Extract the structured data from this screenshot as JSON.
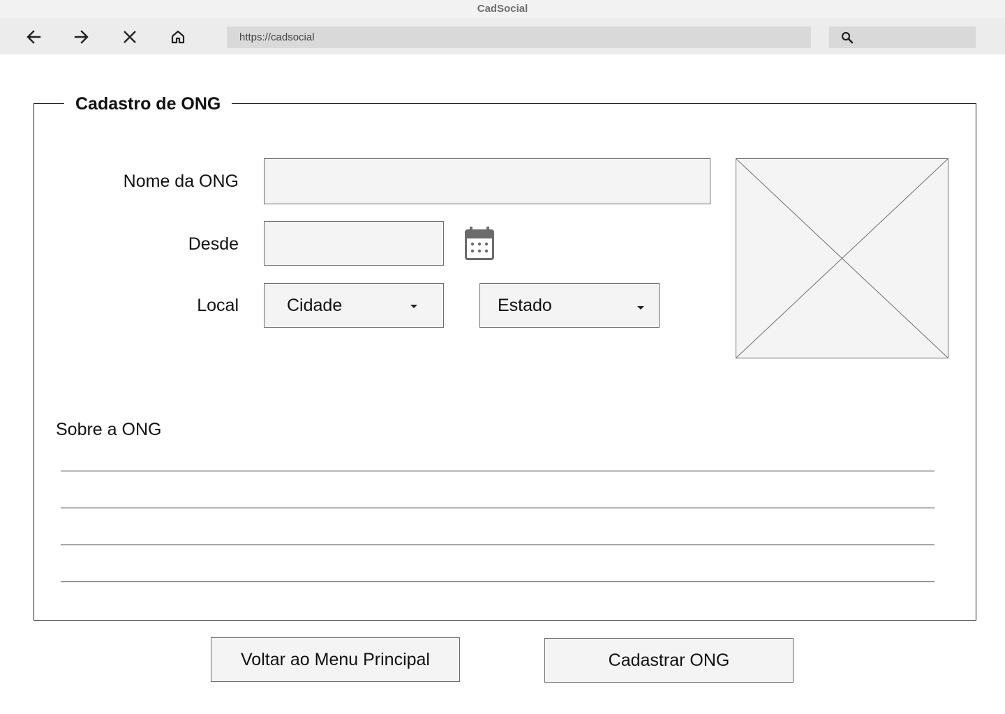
{
  "window": {
    "title": "CadSocial"
  },
  "browser": {
    "url": "https://cadsocial",
    "search_placeholder": "",
    "icons": [
      "back-arrow-icon",
      "forward-arrow-icon",
      "close-icon",
      "home-icon",
      "search-icon"
    ]
  },
  "form": {
    "title": "Cadastro de ONG",
    "name_label": "Nome da ONG",
    "name_value": "",
    "since_label": "Desde",
    "since_value": "",
    "location_label": "Local",
    "city_select": "Cidade",
    "state_select": "Estado",
    "about_label": "Sobre a ONG",
    "about_value": ""
  },
  "actions": {
    "back_label": "Voltar ao Menu Principal",
    "submit_label": "Cadastrar ONG"
  }
}
